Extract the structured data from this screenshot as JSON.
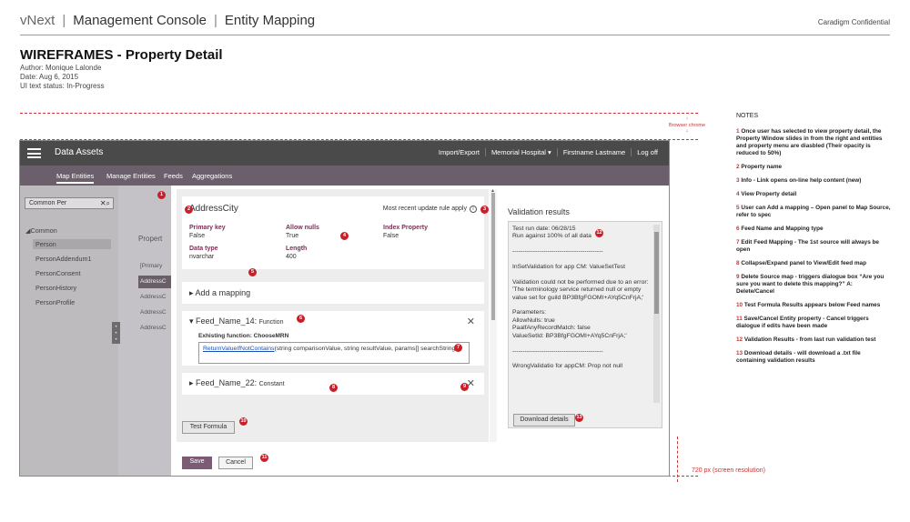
{
  "header": {
    "brand": "vNext",
    "section": "Management Console",
    "page": "Entity Mapping",
    "confidential": "Caradigm Confidential"
  },
  "wireframe": {
    "title": "WIREFRAMES - Property Detail",
    "author": "Author: Monique Lalonde",
    "date": "Date: Aug 6, 2015",
    "status": "UI text status: In-Progress"
  },
  "guides": {
    "browser_chrome": "Browser chrome",
    "screen_resolution": "720 px (screen resolution)"
  },
  "notes": {
    "title": "NOTES",
    "items": [
      {
        "num": "1",
        "text": "Once user has selected to view property detail, the Property Window slides in from the right and entities and property menu are diasbled (Their opacity is reduced to 50%)"
      },
      {
        "num": "2",
        "text": "Property name"
      },
      {
        "num": "3",
        "text": "Info - Link opens on-line help content (new)"
      },
      {
        "num": "4",
        "text": "View Property detail"
      },
      {
        "num": "5",
        "text": "User can Add a mapping – Open panel to Map Source, refer to spec"
      },
      {
        "num": "6",
        "text": "Feed Name and Mapping type"
      },
      {
        "num": "7",
        "text": "Edit Feed Mapping - The 1st source will always be open"
      },
      {
        "num": "8",
        "text": "Collapse/Expand panel to View/Edit feed map"
      },
      {
        "num": "9",
        "text": "Delete Source map - triggers dialogue box “Are you sure you want to delete this mapping?” A: Delete/Cancel"
      },
      {
        "num": "10",
        "text": "Test Formula Results appears below Feed names"
      },
      {
        "num": "11",
        "text": "Save/Cancel Entity property - Cancel triggers dialogue if edits have been made"
      },
      {
        "num": "12",
        "text": "Validation Results - from last run validation test"
      },
      {
        "num": "13",
        "text": "Download details - will download a .txt file containing validation results"
      }
    ]
  },
  "app": {
    "title": "Data Assets",
    "top_links": [
      "Import/Export",
      "Memorial Hospital ▾",
      "Firstname Lastname",
      "Log off"
    ],
    "tabs": [
      "Map Entities",
      "Manage Entities",
      "Feeds",
      "Aggregations"
    ],
    "search_value": "Common Per",
    "tree_group": "Common",
    "tree_items": [
      "Person",
      "PersonAddendum1",
      "PersonConsent",
      "PersonHistory",
      "PersonProfile"
    ],
    "bg_heading": "Propert",
    "bg_rows": [
      "[Primary",
      "AddressC",
      "AddressC",
      "AddressC",
      "AddressC"
    ]
  },
  "property": {
    "name": "AddressCity",
    "rule_label": "Most recent update rule apply",
    "info_glyph": "i",
    "fields": [
      {
        "key": "Primary key",
        "value": "False"
      },
      {
        "key": "Allow nulls",
        "value": "True"
      },
      {
        "key": "Index Property",
        "value": "False"
      },
      {
        "key": "Data type",
        "value": "nvarchar"
      },
      {
        "key": "Length",
        "value": "400"
      }
    ]
  },
  "mapping": {
    "add_label": "Add a mapping",
    "feed1_name": "Feed_Name_14:",
    "feed1_type": "Function",
    "existing_fn": "Exhisting function: ChooseMRN",
    "fn_link": "ReturnValueIfNotContains",
    "fn_rest": "(string comparisonValue, string resultValue, params[] searchStrings)",
    "feed2_name": "Feed_Name_22:",
    "feed2_type": "Constant",
    "test_formula": "Test Formula",
    "save": "Save",
    "cancel": "Cancel"
  },
  "validation": {
    "title": "Validation results",
    "text": "Test run date: 06/28/15\nRun against 100% of all data\n\n--------------------------------------------\n\nInSetValidation for app CM: ValueSetTest\n\nValidation could not be performed due to an error: 'The terminology service returned null or empty value set for guild BP3BfgFGOMI+AYq5CnFrjA;'\n\nParameters:\nAllowNulls: true\nPaalfAnyRecordMatch: false\nValueSetId: BP3BfgFGOMI+AYq5CnFrjA;'\n\n--------------------------------------------\n\nWrongValidatio for appCM: Prop not null",
    "download": "Download details"
  },
  "badges": [
    "1",
    "2",
    "3",
    "4",
    "5",
    "6",
    "7",
    "8",
    "9",
    "10",
    "11",
    "12",
    "13"
  ],
  "colors": {
    "badge": "#c8202a",
    "appbar": "#4a4a4a",
    "subnav": "#6b5f6b",
    "accent": "#7b5c74",
    "field_key": "#7b2f56",
    "guide": "#cc3333"
  }
}
